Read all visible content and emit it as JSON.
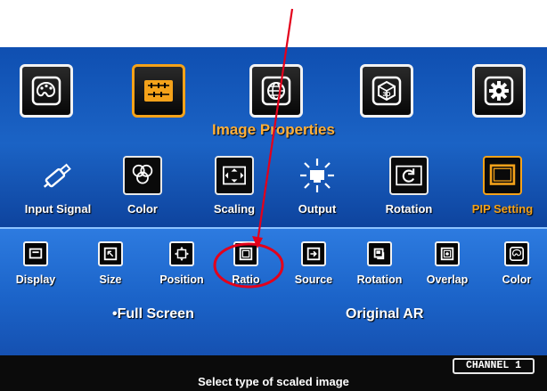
{
  "top_menu": {
    "items": [
      {
        "icon": "palette-icon"
      },
      {
        "icon": "image-properties-icon"
      },
      {
        "icon": "globe-network-icon"
      },
      {
        "icon": "3d-cube-icon"
      },
      {
        "icon": "gear-icon"
      }
    ],
    "active_index": 1,
    "section_title": "Image Properties"
  },
  "sub_menu": {
    "items": [
      {
        "label": "Input Signal",
        "icon": "usb-plug-icon"
      },
      {
        "label": "Color",
        "icon": "color-circles-icon"
      },
      {
        "label": "Scaling",
        "icon": "scaling-arrows-icon"
      },
      {
        "label": "Output",
        "icon": "output-sun-icon"
      },
      {
        "label": "Rotation",
        "icon": "rotation-icon"
      },
      {
        "label": "PIP Setting",
        "icon": "pip-window-icon"
      }
    ],
    "active_index": 5
  },
  "options": {
    "items": [
      {
        "label": "Display",
        "icon": "display-icon"
      },
      {
        "label": "Size",
        "icon": "size-icon"
      },
      {
        "label": "Position",
        "icon": "position-icon"
      },
      {
        "label": "Ratio",
        "icon": "ratio-icon"
      },
      {
        "label": "Source",
        "icon": "source-icon"
      },
      {
        "label": "Rotation",
        "icon": "rotation-small-icon"
      },
      {
        "label": "Overlap",
        "icon": "overlap-icon"
      },
      {
        "label": "Color",
        "icon": "color-small-icon"
      }
    ],
    "highlighted_index": 3,
    "values": {
      "full_screen": "•Full Screen",
      "original_ar": "Original AR"
    }
  },
  "status": {
    "hint": "Select type of scaled image",
    "channel": "CHANNEL 1"
  },
  "colors": {
    "accent": "#f4a21a",
    "annotation": "#e3001b"
  }
}
